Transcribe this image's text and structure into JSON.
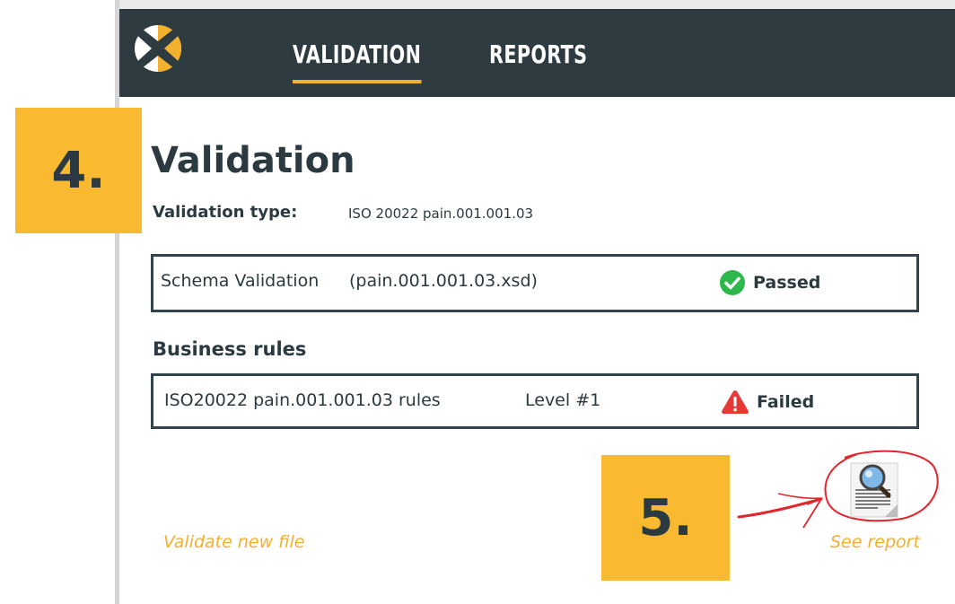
{
  "nav": {
    "tabs": [
      {
        "label": "VALIDATION",
        "active": true
      },
      {
        "label": "REPORTS",
        "active": false
      }
    ],
    "logo": "X logo",
    "bg_color": "#2e3c42",
    "accent_color": "#f3b12d"
  },
  "steps": {
    "step4": "4.",
    "step5": "5."
  },
  "main": {
    "title": "Validation",
    "validation_type_label": "Validation type:",
    "validation_type_value": "ISO 20022 pain.001.001.03"
  },
  "schema": {
    "name": "Schema Validation",
    "file": "(pain.001.001.03.xsd)",
    "status": "Passed",
    "status_icon": "check-circle-icon",
    "status_color": "#2db84b"
  },
  "business_rules": {
    "heading": "Business rules",
    "rule_name": "ISO20022 pain.001.001.03 rules",
    "level": "Level #1",
    "status": "Failed",
    "status_icon": "warning-triangle-icon",
    "status_color": "#e53935"
  },
  "actions": {
    "validate_new": "Validate new file",
    "see_report": "See report",
    "report_icon": "document-magnifier-icon"
  }
}
